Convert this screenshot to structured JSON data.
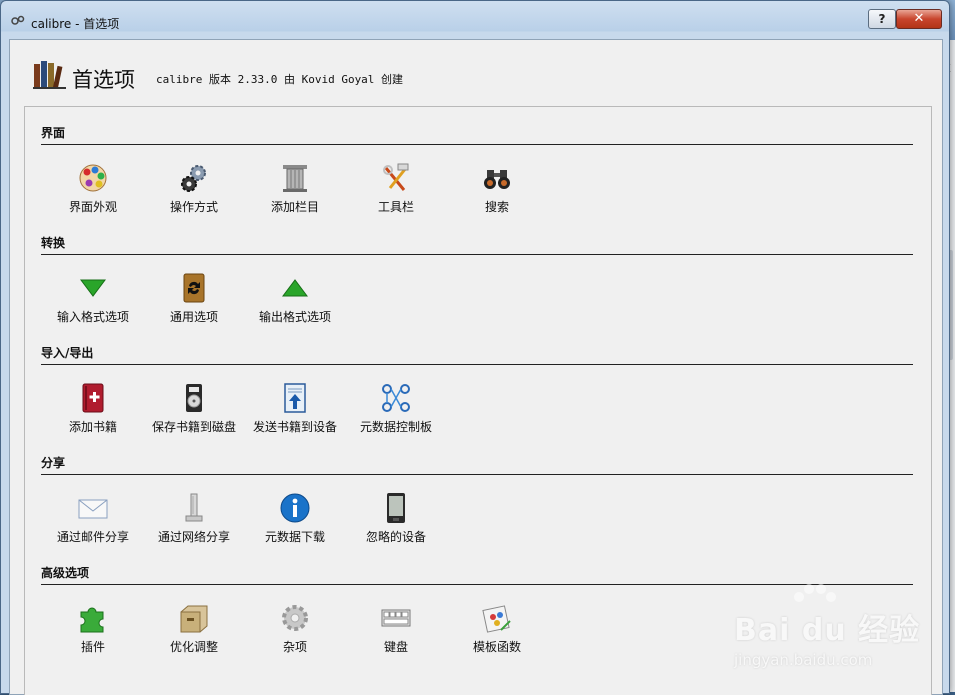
{
  "window": {
    "title": "calibre - 首选项",
    "help_label": "?",
    "close_label": "✕"
  },
  "header": {
    "title": "首选项",
    "subtitle": "calibre 版本 2.33.0 由 Kovid Goyal 创建"
  },
  "sections": [
    {
      "title": "界面",
      "items": [
        {
          "label": "界面外观",
          "icon": "palette-icon"
        },
        {
          "label": "操作方式",
          "icon": "gears-icon"
        },
        {
          "label": "添加栏目",
          "icon": "column-icon"
        },
        {
          "label": "工具栏",
          "icon": "toolbar-tools-icon"
        },
        {
          "label": "搜索",
          "icon": "binoculars-icon"
        }
      ]
    },
    {
      "title": "转换",
      "items": [
        {
          "label": "输入格式选项",
          "icon": "arrow-down-icon"
        },
        {
          "label": "通用选项",
          "icon": "convert-book-icon"
        },
        {
          "label": "输出格式选项",
          "icon": "arrow-up-icon"
        }
      ]
    },
    {
      "title": "导入/导出",
      "items": [
        {
          "label": "添加书籍",
          "icon": "add-book-icon"
        },
        {
          "label": "保存书籍到磁盘",
          "icon": "disk-icon"
        },
        {
          "label": "发送书籍到设备",
          "icon": "send-to-device-icon"
        },
        {
          "label": "元数据控制板",
          "icon": "metadata-plugboard-icon"
        }
      ]
    },
    {
      "title": "分享",
      "items": [
        {
          "label": "通过邮件分享",
          "icon": "mail-icon"
        },
        {
          "label": "通过网络分享",
          "icon": "network-icon"
        },
        {
          "label": "元数据下载",
          "icon": "info-icon"
        },
        {
          "label": "忽略的设备",
          "icon": "ereader-icon"
        }
      ]
    },
    {
      "title": "高级选项",
      "items": [
        {
          "label": "插件",
          "icon": "puzzle-icon"
        },
        {
          "label": "优化调整",
          "icon": "drawer-icon"
        },
        {
          "label": "杂项",
          "icon": "cog-icon"
        },
        {
          "label": "键盘",
          "icon": "keyboard-icon"
        },
        {
          "label": "模板函数",
          "icon": "template-icon"
        }
      ]
    }
  ],
  "watermark": {
    "brand": "Bai du 经验",
    "url": "jingyan.baidu.com"
  },
  "colors": {
    "panel_bg": "#f0f0f0",
    "close_red": "#c8452d",
    "green": "#2aa52a",
    "info_blue": "#1a73c9"
  }
}
